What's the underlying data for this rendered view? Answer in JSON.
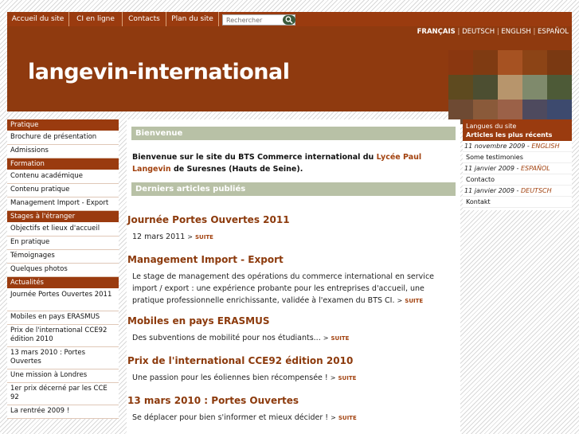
{
  "topnav": {
    "items": [
      "Accueil du site",
      "CI en ligne",
      "Contacts",
      "Plan du site"
    ],
    "search_placeholder": "Rechercher"
  },
  "header": {
    "languages": [
      "FRANÇAIS",
      "DEUTSCH",
      "ENGLISH",
      "ESPAÑOL"
    ],
    "separator": "|",
    "site_title": "langevin-international",
    "mosaic_colors": [
      "#8a3710",
      "#7f3b12",
      "#a65222",
      "#8c4416",
      "#7a3912",
      "#5e4a1f",
      "#4c4e31",
      "#b7956c",
      "#7f8a6c",
      "#4d5a37",
      "#6e4a33",
      "#8a5a3a",
      "#9b6148",
      "#4e4a5e",
      "#3d4a6e"
    ]
  },
  "left_menu": {
    "sections": [
      {
        "title": "Pratique",
        "items": [
          "Brochure de présentation",
          "Admissions"
        ]
      },
      {
        "title": "Formation",
        "items": [
          "Contenu académique",
          "Contenu pratique",
          "Management Import - Export"
        ]
      },
      {
        "title": "Stages à l'étranger",
        "items": [
          "Objectifs et lieux d'accueil",
          "En pratique",
          "Témoignages",
          "Quelques photos"
        ]
      },
      {
        "title": "Actualités",
        "items": [
          "Journée Portes Ouvertes 2011",
          "Mobiles en pays ERASMUS",
          "Prix de l'international CCE92 édition 2010",
          "13 mars 2010 : Portes Ouvertes",
          "Une mission à Londres",
          "1er prix décerné par les CCE 92",
          "La rentrée 2009 !"
        ]
      }
    ]
  },
  "main": {
    "welcome_bar": "Bienvenue",
    "welcome_text_1": "Bienvenue sur le site du BTS Commerce international du ",
    "welcome_school": "Lycée Paul Langevin",
    "welcome_text_2": " de Suresnes (Hauts de Seine).",
    "articles_bar": "Derniers articles publiés",
    "suite_label": "SUITE",
    "arrow": ">",
    "articles": [
      {
        "title": "Journée Portes Ouvertes 2011",
        "text": "12 mars 2011"
      },
      {
        "title": "Management Import - Export",
        "text": "Le stage de management des opérations du commerce international en service import / export : une expérience probante pour les entreprises d'accueil, une pratique professionnelle enrichissante, validée à l'examen du BTS CI."
      },
      {
        "title": "Mobiles en pays ERASMUS",
        "text": "Des subventions de mobilité pour nos étudiants..."
      },
      {
        "title": "Prix de l'international CCE92 édition 2010",
        "text": "Une passion pour les éoliennes bien récompensée !"
      },
      {
        "title": "13 mars 2010 : Portes Ouvertes",
        "text": "Se déplacer pour bien s'informer et mieux décider !"
      }
    ]
  },
  "right_col": {
    "head_line1": "Langues du site",
    "head_line2": "Articles les plus récents",
    "entries": [
      {
        "date": "11 novembre 2009",
        "lang": "ENGLISH",
        "link": "Some testimonies"
      },
      {
        "date": "11 janvier 2009",
        "lang": "ESPAÑOL",
        "link": "Contacto"
      },
      {
        "date": "11 janvier 2009",
        "lang": "DEUTSCH",
        "link": "Kontakt"
      }
    ],
    "date_sep": " - "
  }
}
